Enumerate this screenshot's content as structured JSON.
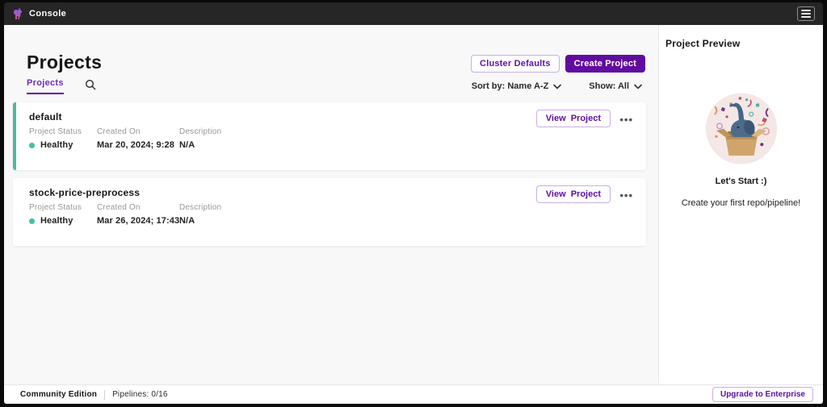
{
  "topbar": {
    "app_title": "Console"
  },
  "header": {
    "title": "Projects",
    "tab_label": "Projects",
    "cluster_defaults_label": "Cluster Defaults",
    "create_project_label": "Create Project"
  },
  "filters": {
    "sort_label": "Sort by: Name A-Z",
    "show_label": "Show: All"
  },
  "columns": {
    "status": "Project Status",
    "created": "Created On",
    "description": "Description"
  },
  "actions": {
    "view_project_label": "View Project",
    "overflow_glyph": "•••"
  },
  "projects": [
    {
      "name": "default",
      "status": "Healthy",
      "created": "Mar 20, 2024; 9:28",
      "description": "N/A"
    },
    {
      "name": "stock-price-preprocess",
      "status": "Healthy",
      "created": "Mar 26, 2024; 17:43",
      "description": "N/A"
    }
  ],
  "preview": {
    "title": "Project Preview",
    "headline": "Let's Start :)",
    "subtext": "Create your first repo/pipeline!"
  },
  "footer": {
    "edition": "Community Edition",
    "pipelines": "Pipelines: 0/16",
    "upgrade_label": "Upgrade to Enterprise"
  },
  "colors": {
    "brand_purple": "#610c9f",
    "outline_purple_border": "#c9aee3",
    "teal_accent": "#50b9a2",
    "healthy_green": "#41bfa6",
    "topbar_bg": "#262626",
    "content_bg": "#f8f8f8"
  }
}
